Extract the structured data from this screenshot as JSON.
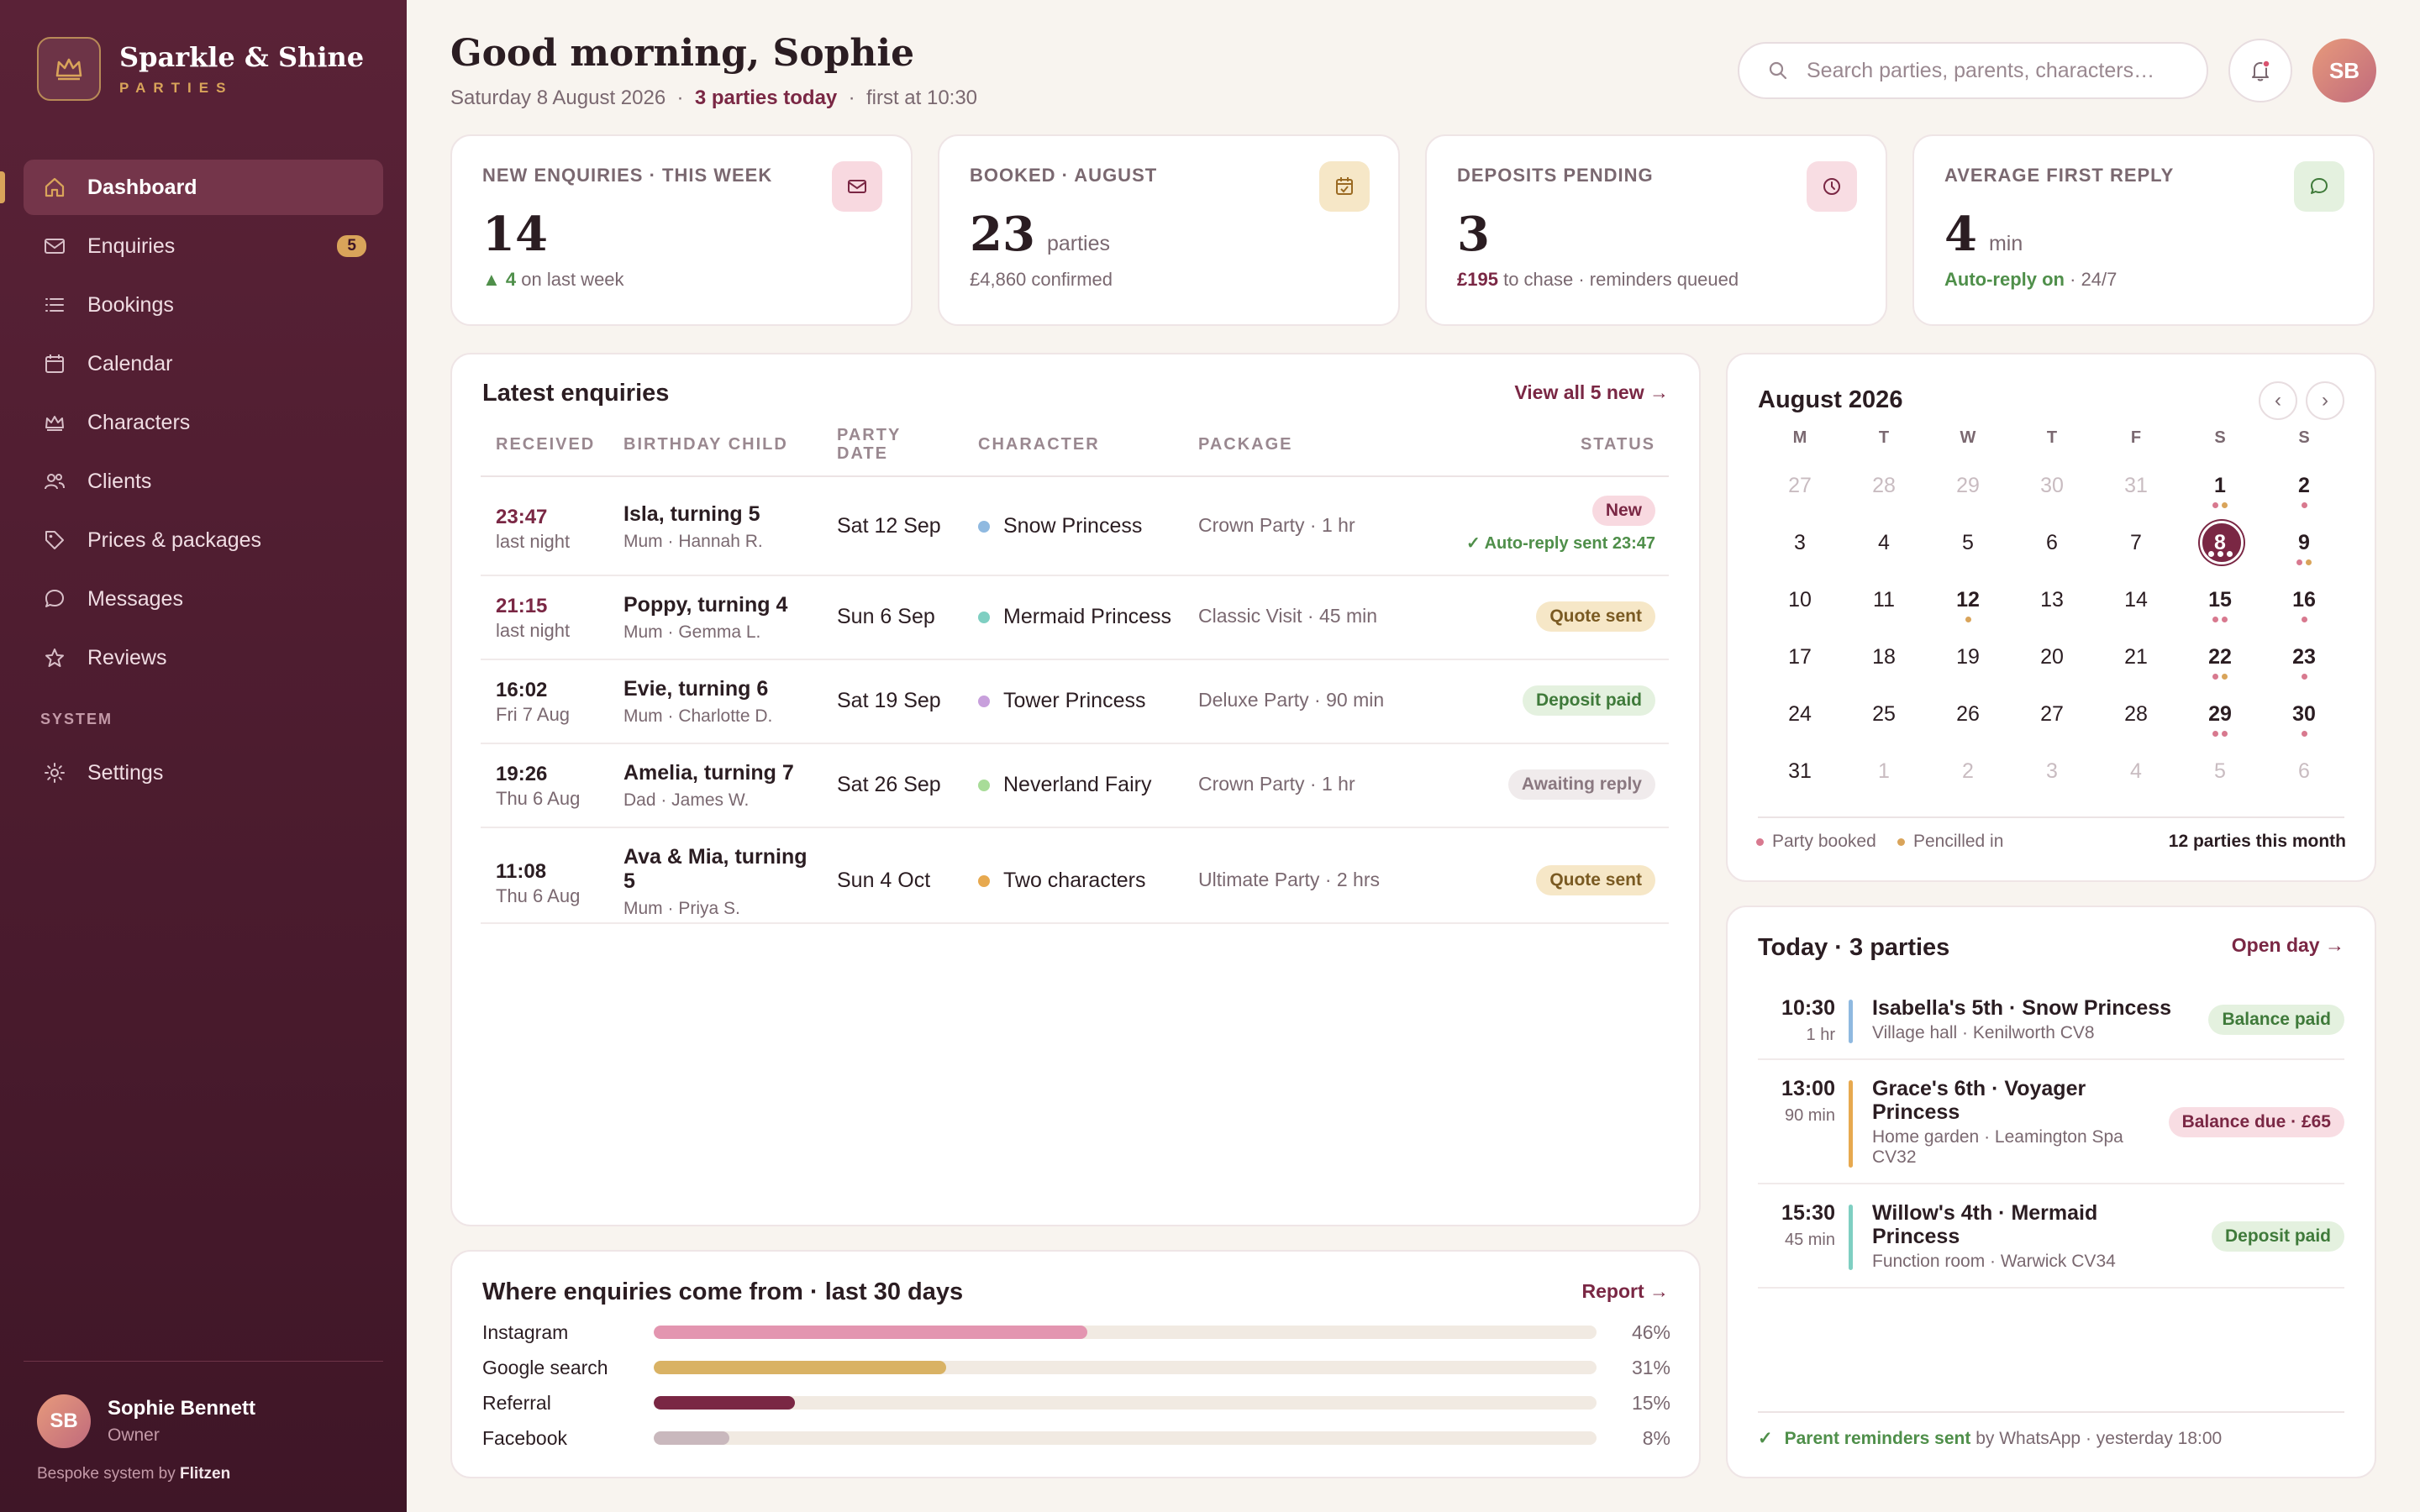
{
  "brand": {
    "name": "Sparkle & Shine",
    "sub": "PARTIES"
  },
  "sidebar": {
    "items": [
      {
        "label": "Dashboard"
      },
      {
        "label": "Enquiries",
        "badge": "5"
      },
      {
        "label": "Bookings"
      },
      {
        "label": "Calendar"
      },
      {
        "label": "Characters"
      },
      {
        "label": "Clients"
      },
      {
        "label": "Prices & packages"
      },
      {
        "label": "Messages"
      },
      {
        "label": "Reviews"
      }
    ],
    "section_system": "SYSTEM",
    "settings": "Settings",
    "user": {
      "initials": "SB",
      "name": "Sophie Bennett",
      "role": "Owner"
    },
    "footer_prefix": "Bespoke system by",
    "footer_brand": "Flitzen"
  },
  "header": {
    "greeting": "Good morning, Sophie",
    "date": "Saturday 8 August 2026",
    "parties_today": "3 parties today",
    "first_at": "first at 10:30",
    "search_placeholder": "Search parties, parents, characters…",
    "avatar_initials": "SB"
  },
  "stats": [
    {
      "label": "NEW ENQUIRIES · THIS WEEK",
      "value": "14",
      "unit": "",
      "note_strong": "▲ 4",
      "note": "on last week"
    },
    {
      "label": "BOOKED · AUGUST",
      "value": "23",
      "unit": "parties",
      "note_strong": "",
      "note": "£4,860 confirmed"
    },
    {
      "label": "DEPOSITS PENDING",
      "value": "3",
      "unit": "",
      "note_strong": "£195",
      "note": "to chase · reminders queued"
    },
    {
      "label": "AVERAGE FIRST REPLY",
      "value": "4",
      "unit": "min",
      "note_strong": "Auto-reply on",
      "note": "· 24/7"
    }
  ],
  "enquiries": {
    "title": "Latest enquiries",
    "link": "View all 5 new →",
    "headers": {
      "received": "RECEIVED",
      "child": "BIRTHDAY CHILD",
      "date": "PARTY DATE",
      "character": "CHARACTER",
      "package": "PACKAGE",
      "status": "STATUS"
    },
    "rows": [
      {
        "time": "23:47",
        "when": "last night",
        "child": "Isla, turning 5",
        "parent": "Mum · Hannah R.",
        "date": "Sat 12 Sep",
        "character": "Snow Princess",
        "package": "Crown Party · 1 hr",
        "status": "New",
        "note": "Auto-reply sent 23:47"
      },
      {
        "time": "21:15",
        "when": "last night",
        "child": "Poppy, turning 4",
        "parent": "Mum · Gemma L.",
        "date": "Sun 6 Sep",
        "character": "Mermaid Princess",
        "package": "Classic Visit · 45 min",
        "status": "Quote sent"
      },
      {
        "time": "16:02",
        "when": "Fri 7 Aug",
        "child": "Evie, turning 6",
        "parent": "Mum · Charlotte D.",
        "date": "Sat 19 Sep",
        "character": "Tower Princess",
        "package": "Deluxe Party · 90 min",
        "status": "Deposit paid"
      },
      {
        "time": "19:26",
        "when": "Thu 6 Aug",
        "child": "Amelia, turning 7",
        "parent": "Dad · James W.",
        "date": "Sat 26 Sep",
        "character": "Neverland Fairy",
        "package": "Crown Party · 1 hr",
        "status": "Awaiting reply"
      },
      {
        "time": "11:08",
        "when": "Thu 6 Aug",
        "child": "Ava & Mia, turning 5",
        "parent": "Mum · Priya S.",
        "date": "Sun 4 Oct",
        "character": "Two characters",
        "package": "Ultimate Party · 2 hrs",
        "status": "Quote sent"
      }
    ]
  },
  "sources": {
    "title": "Where enquiries come from · last 30 days",
    "link": "Report →",
    "items": [
      {
        "label": "Instagram",
        "pct": "46%",
        "value": 46
      },
      {
        "label": "Google search",
        "pct": "31%",
        "value": 31
      },
      {
        "label": "Referral",
        "pct": "15%",
        "value": 15
      },
      {
        "label": "Facebook",
        "pct": "8%",
        "value": 8
      }
    ]
  },
  "calendar": {
    "title": "August 2026",
    "weekdays": [
      "M",
      "T",
      "W",
      "T",
      "F",
      "S",
      "S"
    ],
    "days": [
      "27",
      "28",
      "29",
      "30",
      "31",
      "1",
      "2",
      "3",
      "4",
      "5",
      "6",
      "7",
      "8",
      "9",
      "10",
      "11",
      "12",
      "13",
      "14",
      "15",
      "16",
      "17",
      "18",
      "19",
      "20",
      "21",
      "22",
      "23",
      "24",
      "25",
      "26",
      "27",
      "28",
      "29",
      "30",
      "31",
      "1",
      "2",
      "3",
      "4",
      "5",
      "6"
    ],
    "legend_booked": "Party booked",
    "legend_pencilled": "Pencilled in",
    "summary": "12 parties this month"
  },
  "today": {
    "title": "Today · 3 parties",
    "link": "Open day →",
    "parties": [
      {
        "time": "10:30",
        "duration": "1 hr",
        "title": "Isabella's 5th · Snow Princess",
        "location": "Village hall · Kenilworth CV8",
        "badge": "Balance paid"
      },
      {
        "time": "13:00",
        "duration": "90 min",
        "title": "Grace's 6th · Voyager Princess",
        "location": "Home garden · Leamington Spa CV32",
        "badge": "Balance due · £65"
      },
      {
        "time": "15:30",
        "duration": "45 min",
        "title": "Willow's 4th · Mermaid Princess",
        "location": "Function room · Warwick CV34",
        "badge": "Deposit paid"
      }
    ],
    "reminder_strong": "Parent reminders sent",
    "reminder_rest": "by WhatsApp · yesterday 18:00"
  },
  "colors": {
    "sidebar": "#4d1c2f",
    "accent": "#7a2744",
    "gold": "#d9a45a",
    "snow": "#8fb9e0",
    "mermaid": "#7fcfc2",
    "tower": "#c8a0dc",
    "fairy": "#a8dc98",
    "two": "#e7a94f"
  }
}
